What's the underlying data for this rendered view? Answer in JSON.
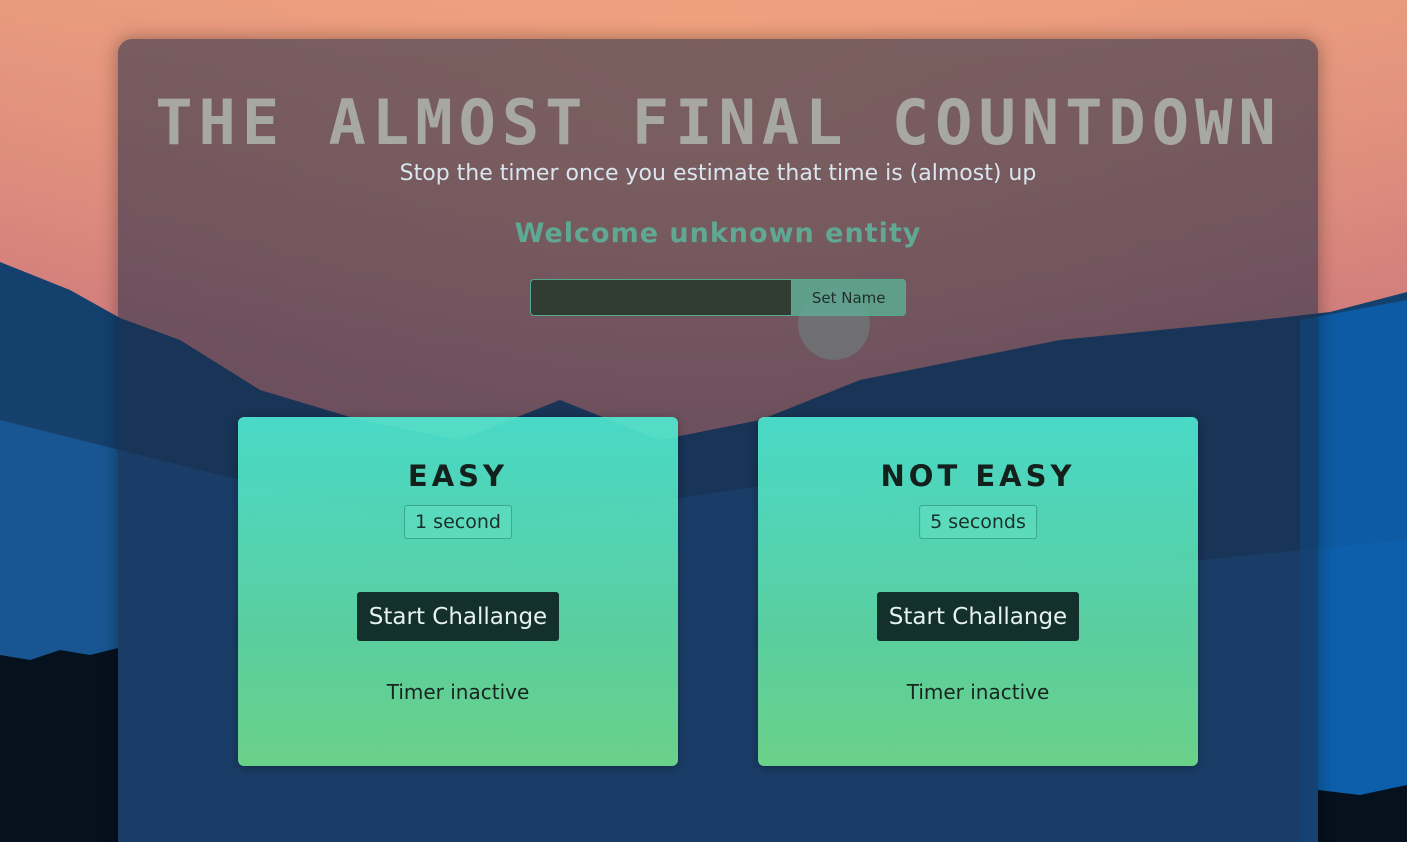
{
  "header": {
    "title": "THE ALMOST FINAL COUNTDOWN",
    "subtitle": "Stop the timer once you estimate that time is (almost) up",
    "welcome": "Welcome unknown entity"
  },
  "name_form": {
    "input_value": "",
    "button_label": "Set Name"
  },
  "challenges": [
    {
      "title": "EASY",
      "duration": "1 second",
      "button_label": "Start Challange",
      "status": "Timer inactive"
    },
    {
      "title": "NOT EASY",
      "duration": "5 seconds",
      "button_label": "Start Challange",
      "status": "Timer inactive"
    }
  ],
  "colors": {
    "accent": "#5fa893",
    "card_top": "#50f0d7",
    "card_bottom": "#73e18c",
    "button_dark": "#14302c"
  }
}
